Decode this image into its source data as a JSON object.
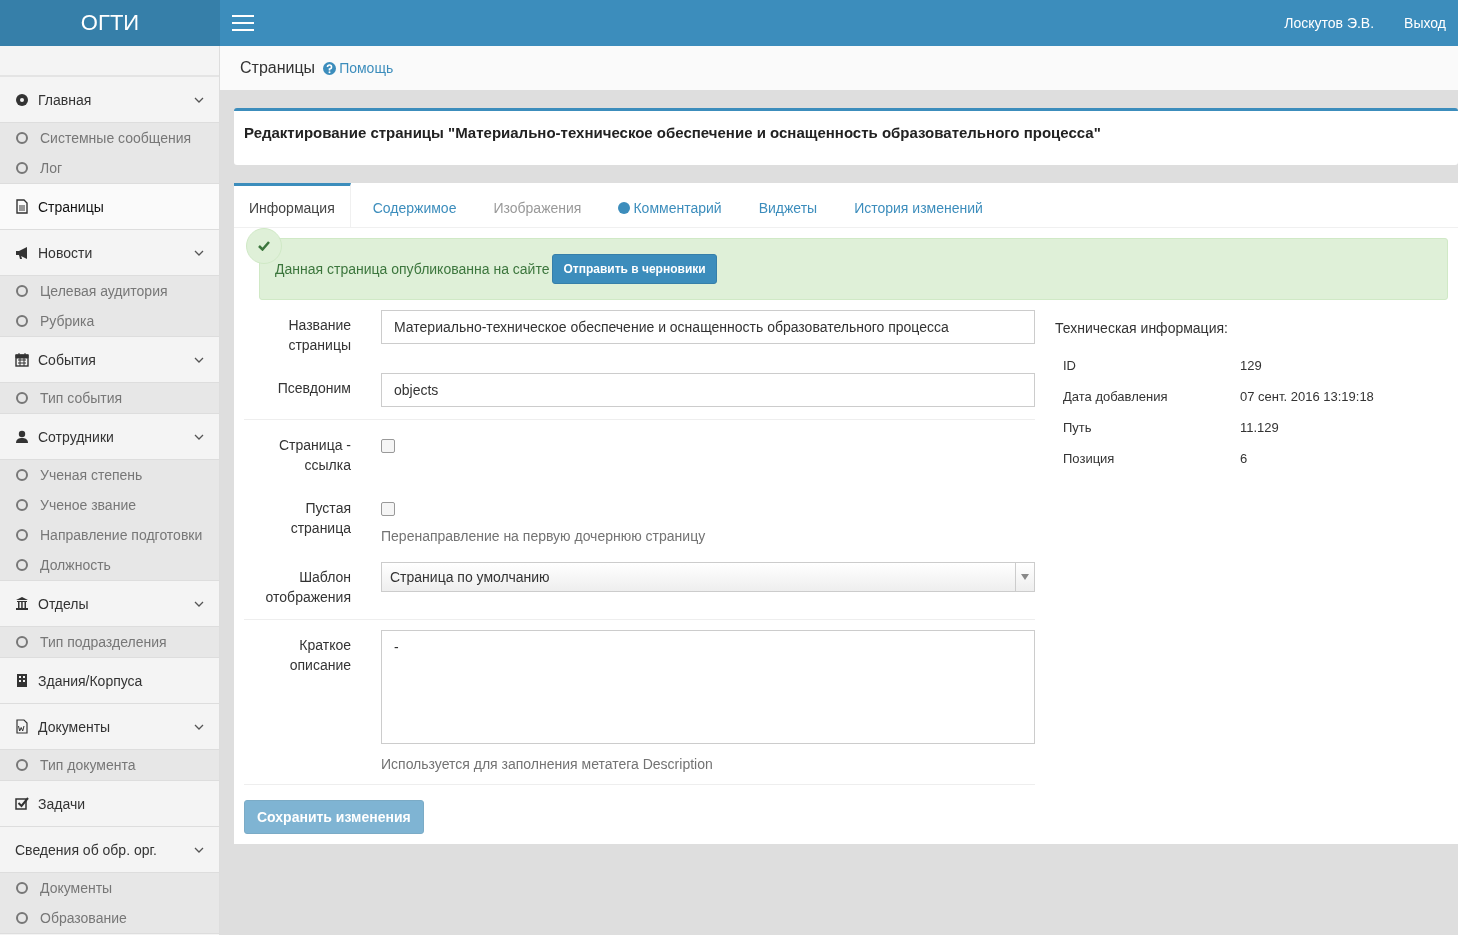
{
  "header": {
    "logo": "ОГТИ",
    "user": "Лоскутов Э.В.",
    "logout": "Выход"
  },
  "sidebar": {
    "items": [
      {
        "label": "Главная",
        "expandable": true,
        "selected": false,
        "children": [
          {
            "label": "Системные сообщения"
          },
          {
            "label": "Лог"
          }
        ]
      },
      {
        "label": "Страницы",
        "expandable": false,
        "selected": true
      },
      {
        "label": "Новости",
        "expandable": true,
        "selected": false,
        "children": [
          {
            "label": "Целевая аудитория"
          },
          {
            "label": "Рубрика"
          }
        ]
      },
      {
        "label": "События",
        "expandable": true,
        "selected": false,
        "children": [
          {
            "label": "Тип события"
          }
        ]
      },
      {
        "label": "Сотрудники",
        "expandable": true,
        "selected": false,
        "children": [
          {
            "label": "Ученая степень"
          },
          {
            "label": "Ученое звание"
          },
          {
            "label": "Направление подготовки"
          },
          {
            "label": "Должность"
          }
        ]
      },
      {
        "label": "Отделы",
        "expandable": true,
        "selected": false,
        "children": [
          {
            "label": "Тип подразделения"
          }
        ]
      },
      {
        "label": "Здания/Корпуса",
        "expandable": false,
        "selected": false
      },
      {
        "label": "Документы",
        "expandable": true,
        "selected": false,
        "children": [
          {
            "label": "Тип документа"
          }
        ]
      },
      {
        "label": "Задачи",
        "expandable": false,
        "selected": false
      },
      {
        "label": "Сведения об обр. орг.",
        "expandable": true,
        "selected": false,
        "children": [
          {
            "label": "Документы"
          },
          {
            "label": "Образование"
          }
        ]
      }
    ]
  },
  "page_header": {
    "title": "Страницы",
    "help": "Помощь"
  },
  "panel_title": "Редактирование страницы \"Материально-техническое обеспечение и оснащенность образовательного процесса\"",
  "tabs": [
    {
      "label": "Информация",
      "selected": true,
      "disabled": false,
      "dot": false
    },
    {
      "label": "Содержимое",
      "selected": false,
      "disabled": false,
      "dot": false
    },
    {
      "label": "Изображения",
      "selected": false,
      "disabled": true,
      "dot": false
    },
    {
      "label": "Комментарий",
      "selected": false,
      "disabled": false,
      "dot": true
    },
    {
      "label": "Виджеты",
      "selected": false,
      "disabled": false,
      "dot": false
    },
    {
      "label": "История изменений",
      "selected": false,
      "disabled": false,
      "dot": false
    }
  ],
  "alert": {
    "text": "Данная страница опубликованна на сайте",
    "button": "Отправить в черновики"
  },
  "form": {
    "sections": [
      [
        {
          "kind": "text",
          "label": "Название страницы",
          "value": "Материально-техническое обеспечение и оснащенность образовательного процесса"
        },
        {
          "kind": "text",
          "label": "Псевдоним",
          "value": "objects"
        }
      ],
      [
        {
          "kind": "checkbox",
          "label": "Страница - ссылка",
          "checked": false
        },
        {
          "kind": "checkbox",
          "label": "Пустая страница",
          "checked": false,
          "help": "Перенаправление на первую дочернюю страницу"
        },
        {
          "kind": "select",
          "label": "Шаблон отображения",
          "value": "Страница по умолчанию"
        }
      ],
      [
        {
          "kind": "textarea",
          "label": "Краткое описание",
          "value": "-",
          "help": "Используется для заполнения метатега Description"
        }
      ]
    ]
  },
  "save_button": {
    "label": "Сохранить изменения",
    "disabled": true
  },
  "tech_info": {
    "title": "Техническая информация:",
    "rows": [
      {
        "label": "ID",
        "value": "129"
      },
      {
        "label": "Дата добавления",
        "value": "07 сент. 2016 13:19:18"
      },
      {
        "label": "Путь",
        "value": "11.129"
      },
      {
        "label": "Позиция",
        "value": "6"
      }
    ]
  }
}
